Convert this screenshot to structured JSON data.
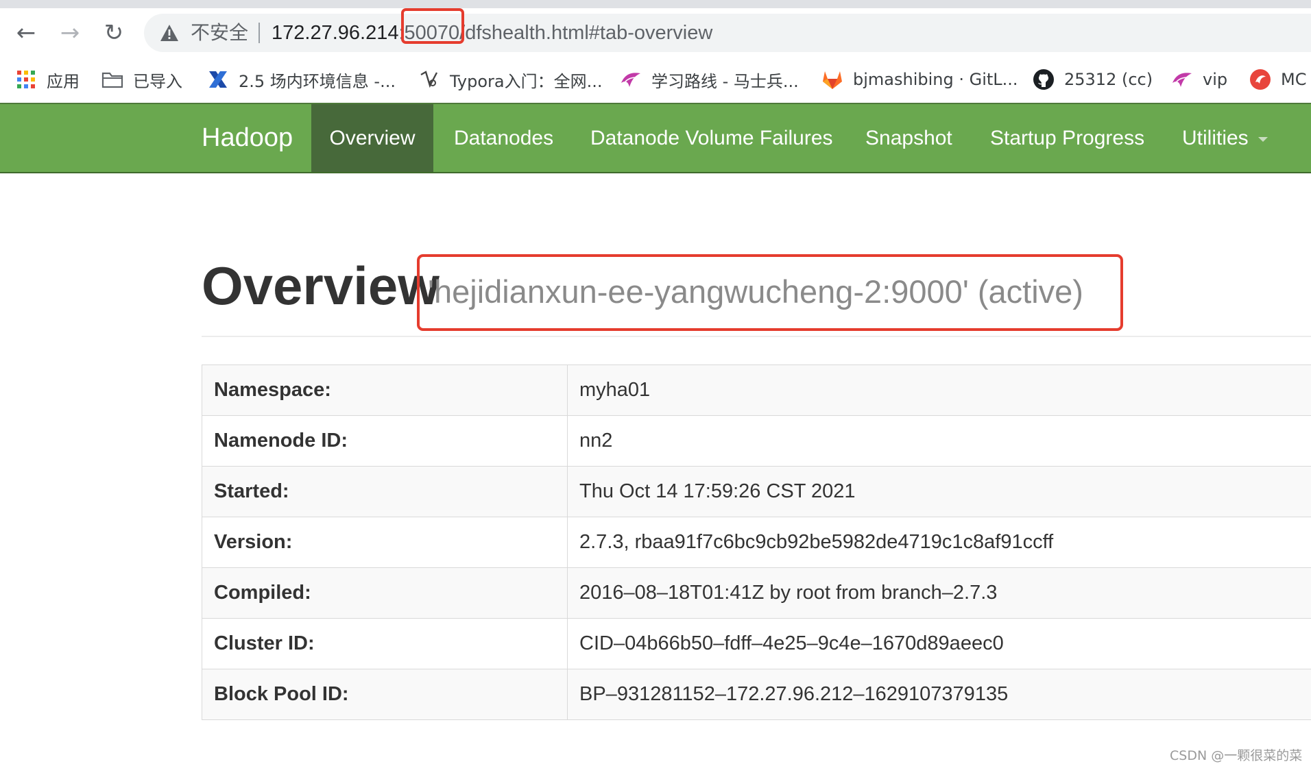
{
  "browser": {
    "insecure_label": "不安全",
    "url_host": "172.27.96.214",
    "url_rest": ":50070/dfshealth.html#tab-overview",
    "back_glyph": "←",
    "forward_glyph": "→",
    "reload_glyph": "↻",
    "icons": {
      "back": "back-arrow-icon",
      "forward": "forward-arrow-icon",
      "reload": "reload-icon",
      "warning": "warning-triangle-icon"
    }
  },
  "bookmarks": [
    {
      "label": "应用",
      "icon": "apps-grid-icon"
    },
    {
      "label": "已导入",
      "icon": "folder-icon"
    },
    {
      "label": "2.5 场内环境信息 -...",
      "icon": "confluence-x-icon"
    },
    {
      "label": "Typora入门：全网...",
      "icon": "typora-icon"
    },
    {
      "label": "学习路线 - 马士兵...",
      "icon": "bird-icon"
    },
    {
      "label": "bjmashibing · GitL...",
      "icon": "gitlab-fox-icon"
    },
    {
      "label": "25312 (cc)",
      "icon": "github-icon"
    },
    {
      "label": "vip",
      "icon": "bird-icon"
    },
    {
      "label": "MC",
      "icon": "red-circle-icon"
    }
  ],
  "navbar": {
    "brand": "Hadoop",
    "items": [
      {
        "label": "Overview"
      },
      {
        "label": "Datanodes"
      },
      {
        "label": "Datanode Volume Failures"
      },
      {
        "label": "Snapshot"
      },
      {
        "label": "Startup Progress"
      },
      {
        "label": "Utilities"
      }
    ]
  },
  "overview": {
    "title": "Overview",
    "subtitle": "'hejidianxun-ee-yangwucheng-2:9000' (active)",
    "rows": [
      {
        "label": "Namespace:",
        "value": "myha01"
      },
      {
        "label": "Namenode ID:",
        "value": "nn2"
      },
      {
        "label": "Started:",
        "value": "Thu Oct 14 17:59:26 CST 2021"
      },
      {
        "label": "Version:",
        "value": "2.7.3, rbaa91f7c6bc9cb92be5982de4719c1c8af91ccff"
      },
      {
        "label": "Compiled:",
        "value": "2016–08–18T01:41Z by root from branch–2.7.3"
      },
      {
        "label": "Cluster ID:",
        "value": "CID–04b66b50–fdff–4e25–9c4e–1670d89aeec0"
      },
      {
        "label": "Block Pool ID:",
        "value": "BP–931281152–172.27.96.212–1629107379135"
      }
    ]
  },
  "watermark": "CSDN @一颗很菜的菜",
  "colors": {
    "navbar_green": "#6aa84f",
    "navbar_active": "#47693a",
    "annotation_red": "#e53c2e",
    "subtitle_gray": "#8a8a8a"
  }
}
